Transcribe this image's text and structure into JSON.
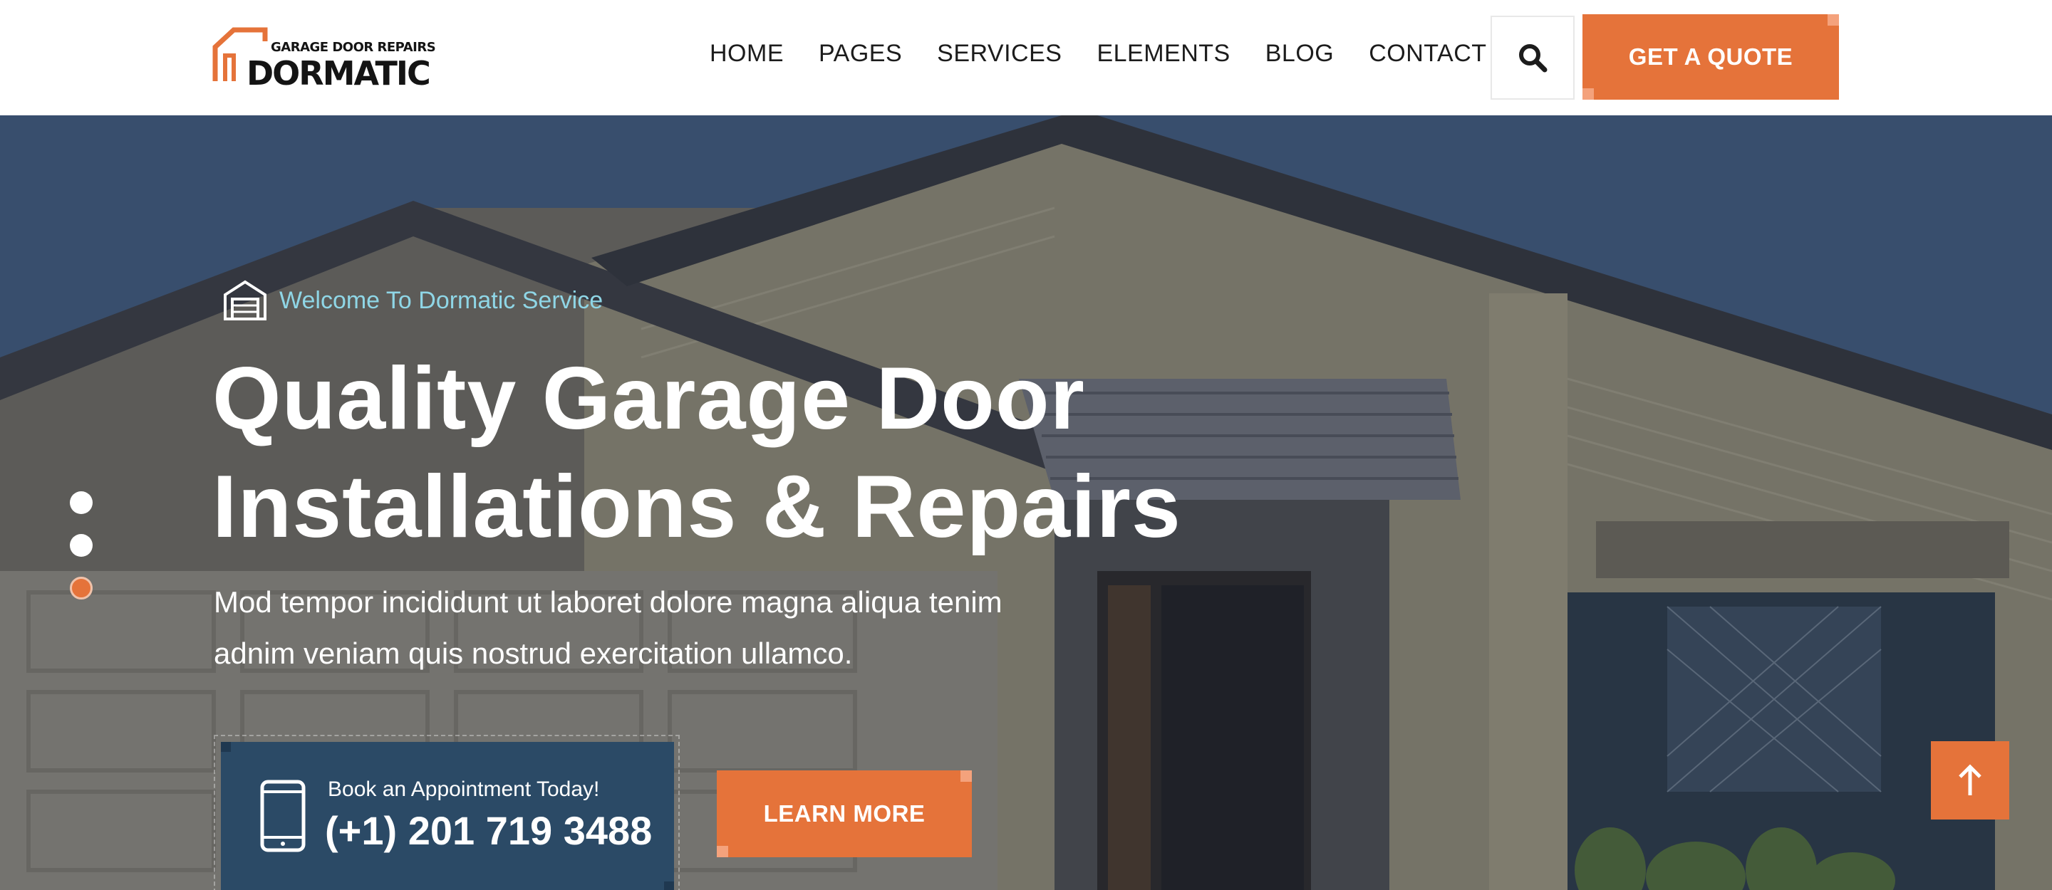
{
  "header": {
    "logo": {
      "tagline": "GARAGE DOOR REPAIRS",
      "name": "DORMATIC"
    },
    "nav": [
      "HOME",
      "PAGES",
      "SERVICES",
      "ELEMENTS",
      "BLOG",
      "CONTACT"
    ],
    "search_icon": "search-icon",
    "quote_label": "GET A QUOTE"
  },
  "hero": {
    "welcome_icon": "garage-icon",
    "welcome": "Welcome To Dormatic Service",
    "title_line1": "Quality Garage Door",
    "title_line2": "Installations & Repairs",
    "desc_line1": "Mod tempor incididunt ut laboret dolore magna aliqua tenim",
    "desc_line2": "adnim veniam quis nostrud exercitation ullamco.",
    "appointment": {
      "icon": "phone-icon",
      "label": "Book an Appointment Today!",
      "phone": "(+1) 201 719 3488"
    },
    "learn_more_label": "LEARN MORE",
    "slider_dots": 3,
    "active_dot": 3,
    "scroll_top_icon": "arrow-up-icon"
  },
  "colors": {
    "accent": "#e5733a",
    "accent_light": "#f4a27c",
    "welcome_text": "#8fd6e6",
    "appointment_bg": "#2b4a66",
    "text_dark": "#1c1c1c"
  }
}
